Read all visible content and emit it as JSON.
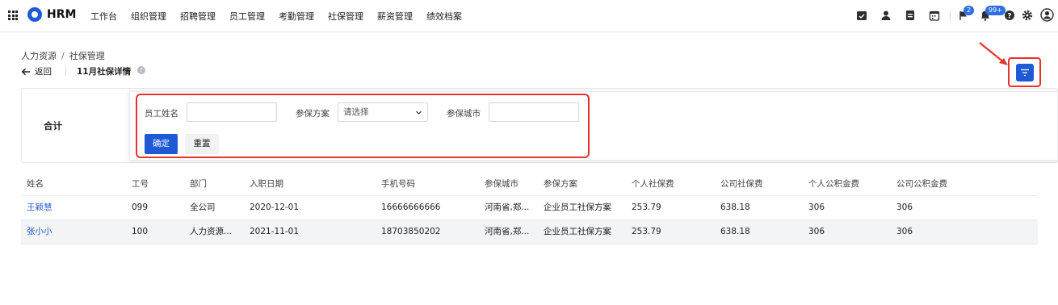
{
  "brand": {
    "name": "HRM"
  },
  "nav": [
    "工作台",
    "组织管理",
    "招聘管理",
    "员工管理",
    "考勤管理",
    "社保管理",
    "薪资管理",
    "绩效档案"
  ],
  "toolbar": {
    "icons": [
      "calendar-check-icon",
      "user-icon",
      "document-icon",
      "calendar-icon",
      "flag-icon",
      "bell-icon",
      "help-icon",
      "gear-icon",
      "account-icon"
    ],
    "flag_badge": "2",
    "bell_badge": "99+"
  },
  "breadcrumb": {
    "parent": "人力资源",
    "current": "社保管理",
    "separator": "/"
  },
  "header": {
    "back_label": "返回",
    "title": "11月社保详情"
  },
  "summary": {
    "label": "合计"
  },
  "filter": {
    "name_label": "员工姓名",
    "name_value": "",
    "plan_label": "参保方案",
    "plan_placeholder": "请选择",
    "city_label": "参保城市",
    "city_value": "",
    "confirm_label": "确定",
    "reset_label": "重置"
  },
  "table": {
    "columns": [
      "姓名",
      "工号",
      "部门",
      "入职日期",
      "手机号码",
      "参保城市",
      "参保方案",
      "个人社保费",
      "公司社保费",
      "个人公积金费",
      "公司公积金费"
    ],
    "rows": [
      [
        "王颖慧",
        "099",
        "全公司",
        "2020-12-01",
        "16666666666",
        "河南省,郑...",
        "企业员工社保方案",
        "253.79",
        "638.18",
        "306",
        "306"
      ],
      [
        "张小小",
        "100",
        "人力资源...",
        "2021-11-01",
        "18703850202",
        "河南省,郑...",
        "企业员工社保方案",
        "253.79",
        "638.18",
        "306",
        "306"
      ]
    ]
  },
  "colors": {
    "primary": "#1f5ad6",
    "highlight": "#e8332b"
  }
}
